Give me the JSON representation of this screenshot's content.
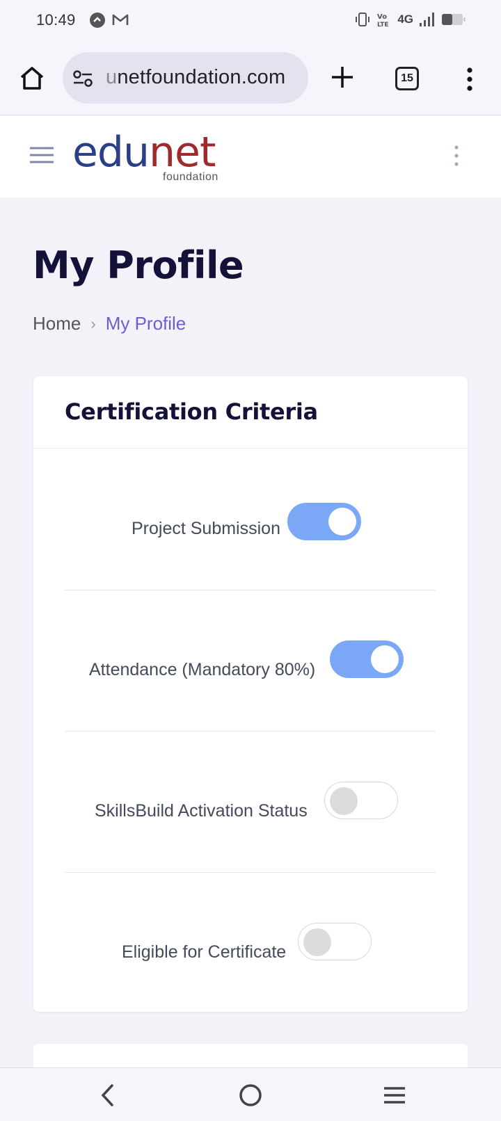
{
  "status_bar": {
    "time": "10:49",
    "network": "4G",
    "icons": [
      "app-notification-icon",
      "gmail-icon",
      "vibrate-icon",
      "volte-icon",
      "signal-icon",
      "battery-icon"
    ]
  },
  "browser": {
    "url_faded": "u",
    "url": "netfoundation.com",
    "tab_count": "15"
  },
  "site": {
    "logo_edu": "edu",
    "logo_net": "net",
    "logo_sub": "foundation"
  },
  "page": {
    "title": "My Profile",
    "breadcrumb": {
      "home": "Home",
      "separator": "›",
      "current": "My Profile"
    }
  },
  "card": {
    "title": "Certification Criteria",
    "criteria": [
      {
        "label": "Project Submission",
        "enabled": true
      },
      {
        "label": "Attendance (Mandatory 80%)",
        "enabled": true
      },
      {
        "label": "SkillsBuild Activation Status",
        "enabled": false
      },
      {
        "label": "Eligible for Certificate",
        "enabled": false
      }
    ]
  },
  "colors": {
    "toggle_on": "#7aa8f7",
    "title": "#15123a",
    "breadcrumb_active": "#6a5fd0",
    "logo_edu": "#2b3f87",
    "logo_net": "#9e2a2b"
  }
}
